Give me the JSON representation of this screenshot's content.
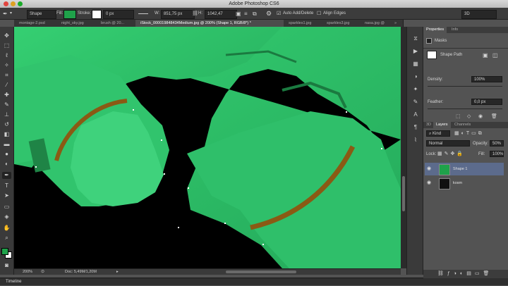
{
  "app": {
    "title": "Adobe Photoshop CS6"
  },
  "options_bar": {
    "mode": "Shape",
    "fill_label": "Fill:",
    "stroke_label": "Stroke:",
    "stroke_width": "0 px",
    "w_label": "W:",
    "w_value": "851,75 px",
    "h_label": "H:",
    "h_value": "1042,47",
    "auto_add_delete": "Auto Add/Delete",
    "align_edges": "Align Edges",
    "workspace": "3D",
    "fill_color": "#1fa24a"
  },
  "tabs": [
    {
      "label": "montage-2.psd"
    },
    {
      "label": "night_sky.jpg"
    },
    {
      "label": "brush @ 20..."
    },
    {
      "label": "iStock_000019848434Medium.jpg @ 200% (Shape 1, RGB/8*) *"
    },
    {
      "label": "sparkles1.jpg"
    },
    {
      "label": "sparkles3.jpg"
    },
    {
      "label": "nasa.jpg @"
    }
  ],
  "status": {
    "zoom": "200%",
    "doc": "Doc: 5,49M/1,20M"
  },
  "timeline": {
    "label": "Timeline"
  },
  "properties": {
    "tab_properties": "Properties",
    "tab_info": "Info",
    "masks_label": "Masks",
    "shape_path": "Shape Path",
    "density_label": "Density:",
    "density_value": "100%",
    "feather_label": "Feather:",
    "feather_value": "0,0 px"
  },
  "layers": {
    "tab_3d": "3D",
    "tab_layers": "Layers",
    "tab_channels": "Channels",
    "filter_kind": "Kind",
    "blend_mode": "Normal",
    "opacity_label": "Opacity:",
    "opacity_value": "50%",
    "lock_label": "Lock:",
    "fill_label": "Fill:",
    "fill_value": "100%",
    "items": [
      {
        "name": "Shape 1"
      },
      {
        "name": "kosm"
      }
    ]
  },
  "colors": {
    "foreground": "#1fa24a",
    "background": "#ffffff",
    "overlay": "#2dc46a",
    "stripe": "#8a5a14"
  }
}
